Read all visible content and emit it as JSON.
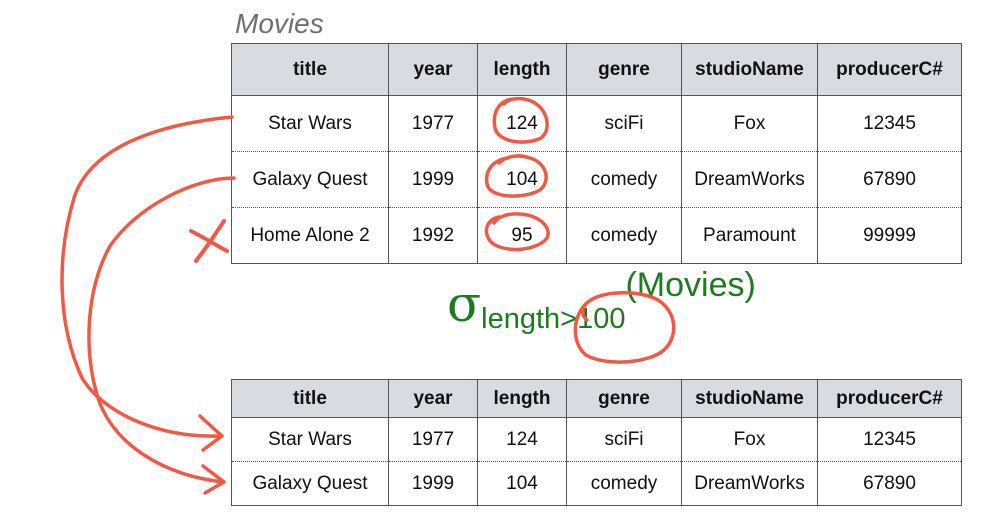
{
  "caption": "Movies",
  "columns": [
    "title",
    "year",
    "length",
    "genre",
    "studioName",
    "producerC#"
  ],
  "source_rows": [
    [
      "Star Wars",
      "1977",
      "124",
      "sciFi",
      "Fox",
      "12345"
    ],
    [
      "Galaxy Quest",
      "1999",
      "104",
      "comedy",
      "DreamWorks",
      "67890"
    ],
    [
      "Home Alone 2",
      "1992",
      "95",
      "comedy",
      "Paramount",
      "99999"
    ]
  ],
  "result_rows": [
    [
      "Star Wars",
      "1977",
      "124",
      "sciFi",
      "Fox",
      "12345"
    ],
    [
      "Galaxy Quest",
      "1999",
      "104",
      "comedy",
      "DreamWorks",
      "67890"
    ]
  ],
  "selection": {
    "symbol": "σ",
    "attribute": "length",
    "condition": ">100",
    "relation": "(Movies)"
  },
  "annotation_colors": {
    "ink": "#ef5a46",
    "expression": "#1f7a1f",
    "header_fill": "#d8dce1"
  }
}
